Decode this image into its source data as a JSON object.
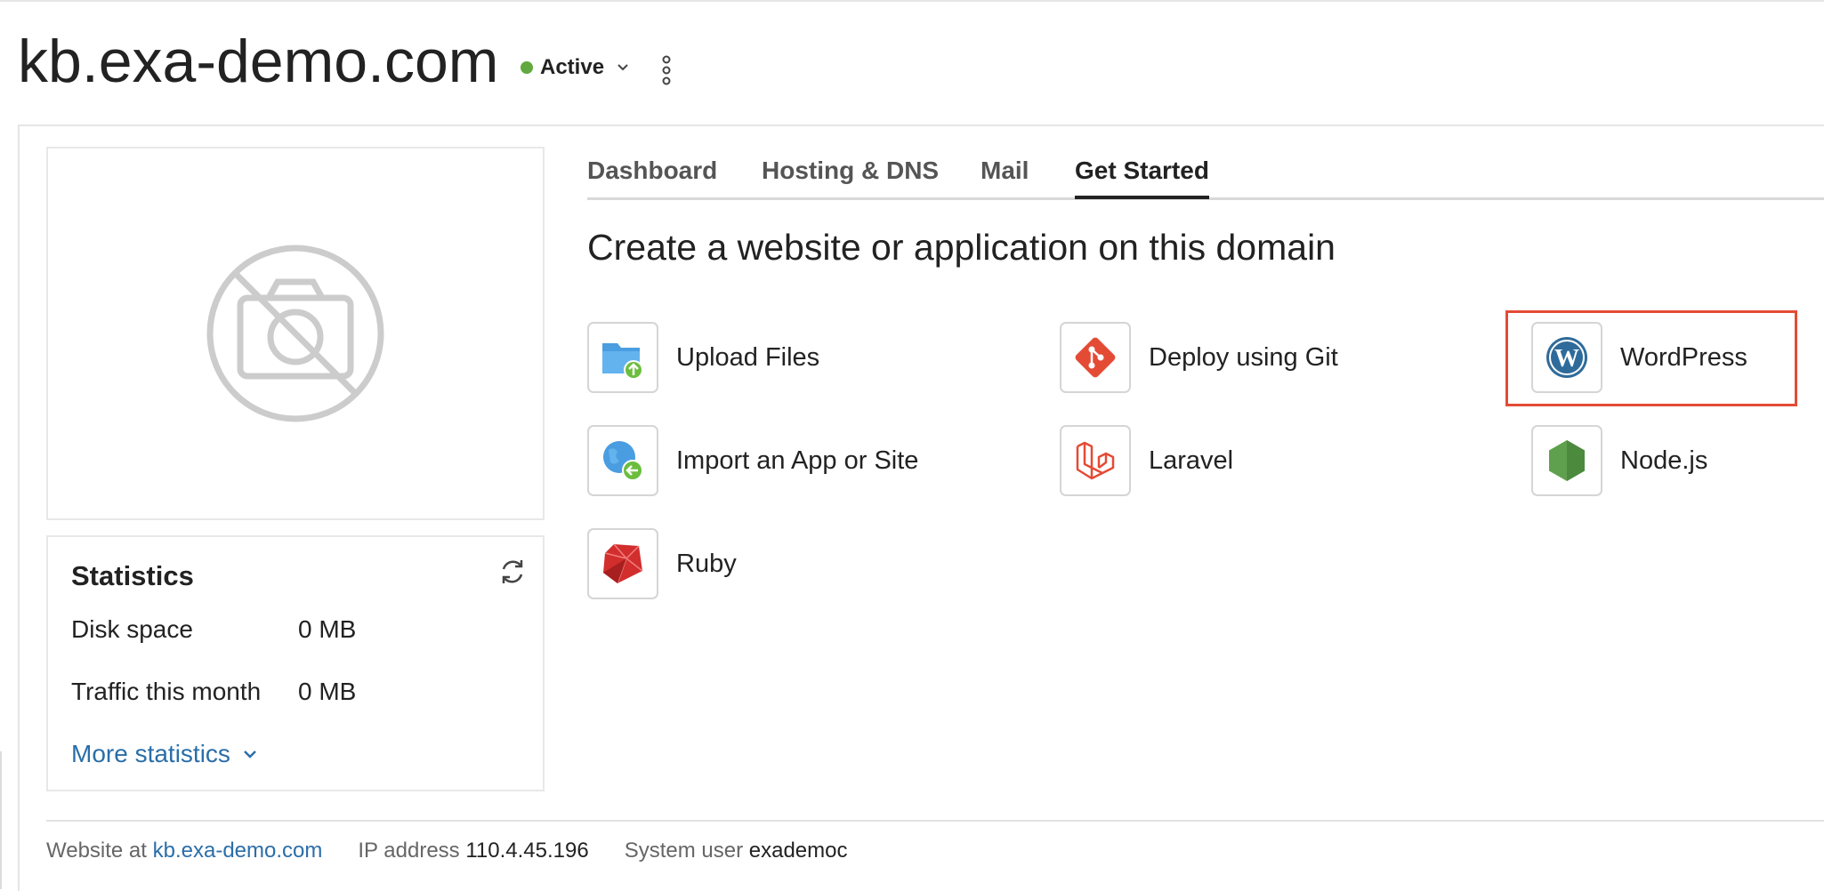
{
  "header": {
    "domain_title": "kb.exa-demo.com",
    "status_label": "Active",
    "status_color": "#61a83f"
  },
  "preview": {
    "icon": "no-camera-icon"
  },
  "stats": {
    "title": "Statistics",
    "rows": [
      {
        "label": "Disk space",
        "value": "0 MB"
      },
      {
        "label": "Traffic this month",
        "value": "0 MB"
      }
    ],
    "more_label": "More statistics"
  },
  "tabs": [
    {
      "label": "Dashboard",
      "active": false
    },
    {
      "label": "Hosting & DNS",
      "active": false
    },
    {
      "label": "Mail",
      "active": false
    },
    {
      "label": "Get Started",
      "active": true
    }
  ],
  "main": {
    "heading": "Create a website or application on this domain",
    "apps": [
      {
        "label": "Upload Files",
        "icon": "upload-folder-icon"
      },
      {
        "label": "Deploy using Git",
        "icon": "git-icon"
      },
      {
        "label": "WordPress",
        "icon": "wordpress-icon",
        "highlighted": true
      },
      {
        "label": "Import an App or Site",
        "icon": "import-globe-icon"
      },
      {
        "label": "Laravel",
        "icon": "laravel-icon"
      },
      {
        "label": "Node.js",
        "icon": "nodejs-icon"
      },
      {
        "label": "Ruby",
        "icon": "ruby-icon"
      }
    ]
  },
  "footer": {
    "website_prefix": "Website at",
    "website_link": "kb.exa-demo.com",
    "ip_label": "IP address",
    "ip_value": "110.4.45.196",
    "sysuser_label": "System user",
    "sysuser_value": "exademoc"
  },
  "colors": {
    "accent_link": "#2a6ea8",
    "highlight_border": "#e44b35"
  }
}
